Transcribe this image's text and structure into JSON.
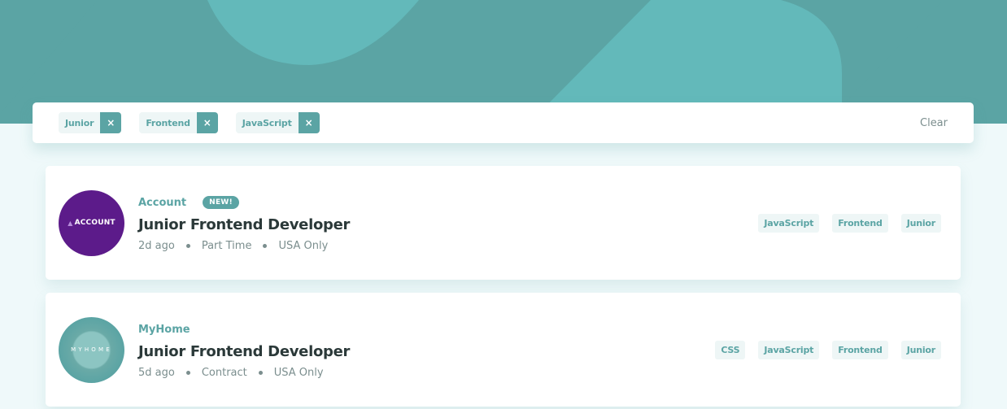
{
  "theme": {
    "primary": "#5ba4a4",
    "background": "#eff9fa",
    "tag_bg": "#eef6f6",
    "text_dark": "#2b3939",
    "text_muted": "#7b8e8e"
  },
  "filters": {
    "chips": [
      "Junior",
      "Frontend",
      "JavaScript"
    ],
    "remove_glyph": "×",
    "clear_label": "Clear"
  },
  "jobs": [
    {
      "company": "Account",
      "logo_text": "ACCOUNT",
      "badge": "NEW!",
      "position": "Junior Frontend Developer",
      "posted": "2d ago",
      "contract": "Part Time",
      "location": "USA Only",
      "tags": [
        "JavaScript",
        "Frontend",
        "Junior"
      ]
    },
    {
      "company": "MyHome",
      "logo_text": "MYHOME",
      "position": "Junior Frontend Developer",
      "posted": "5d ago",
      "contract": "Contract",
      "location": "USA Only",
      "tags": [
        "CSS",
        "JavaScript",
        "Frontend",
        "Junior"
      ]
    }
  ]
}
